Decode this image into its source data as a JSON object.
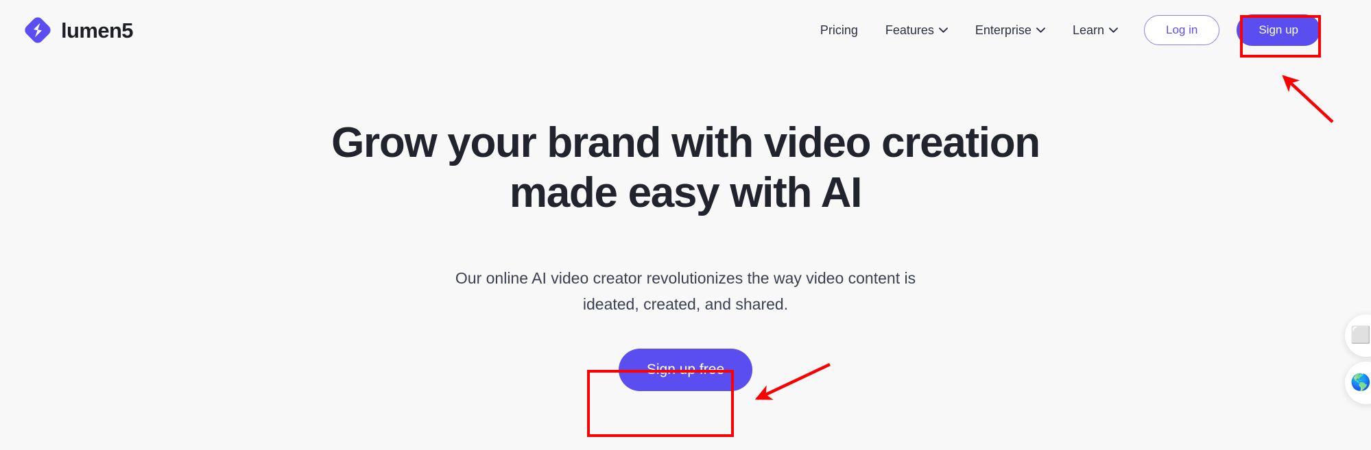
{
  "brand": {
    "name": "lumen5",
    "logo_icon": "lumen5-logo-icon",
    "color": "#5b4ef0"
  },
  "nav": {
    "items": [
      {
        "label": "Pricing",
        "has_dropdown": false
      },
      {
        "label": "Features",
        "has_dropdown": true
      },
      {
        "label": "Enterprise",
        "has_dropdown": true
      },
      {
        "label": "Learn",
        "has_dropdown": true
      }
    ],
    "login_label": "Log in",
    "signup_label": "Sign up"
  },
  "hero": {
    "headline": "Grow your brand with video creation made easy with AI",
    "subhead": "Our online AI video creator revolutionizes the way video content is ideated, created, and shared.",
    "cta_label": "Sign up free"
  },
  "side_widgets": [
    {
      "name": "feedback-widget",
      "glyph": "⬜"
    },
    {
      "name": "language-widget",
      "glyph": "🌎"
    }
  ],
  "annotations": {
    "highlight_color": "#fb0000",
    "boxes": [
      {
        "target": "signup-button"
      },
      {
        "target": "sign-up-free-button"
      }
    ],
    "arrows": [
      {
        "target": "signup-button",
        "direction": "up-left"
      },
      {
        "target": "sign-up-free-button",
        "direction": "down-left"
      }
    ]
  },
  "colors": {
    "page_background": "#f8f8f9",
    "primary": "#5b4ef0",
    "text_dark": "#21242c",
    "text_body": "#3b4050"
  }
}
